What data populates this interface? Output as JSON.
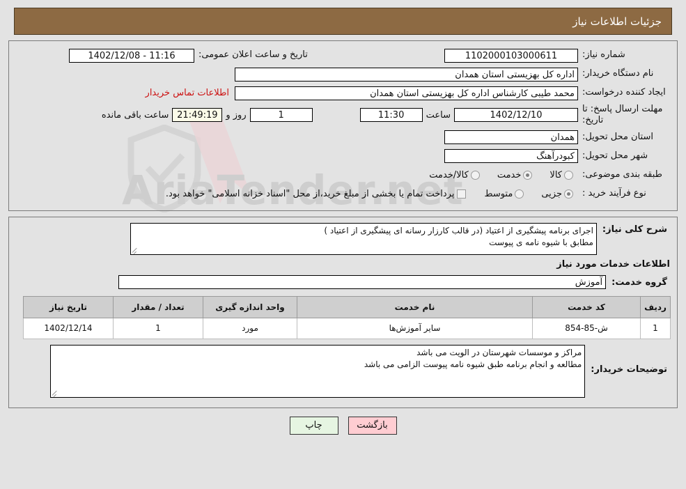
{
  "header": {
    "title": "جزئیات اطلاعات نیاز"
  },
  "form": {
    "need_number_label": "شماره نیاز:",
    "need_number_value": "1102000103000611",
    "announce_label": "تاریخ و ساعت اعلان عمومی:",
    "announce_value": "11:16 - 1402/12/08",
    "buyer_org_label": "نام دستگاه خریدار:",
    "buyer_org_value": "اداره کل بهزیستی استان همدان",
    "creator_label": "ایجاد کننده درخواست:",
    "creator_value": "محمد طیبی کارشناس اداره کل بهزیستی استان همدان",
    "contact_link": "اطلاعات تماس خریدار",
    "deadline_label": "مهلت ارسال پاسخ: تا تاریخ:",
    "deadline_date": "1402/12/10",
    "hour_word": "ساعت",
    "deadline_time": "11:30",
    "remaining_days": "1",
    "days_word": "روز و",
    "remaining_timer": "21:49:19",
    "remaining_suffix": "ساعت باقی مانده",
    "province_label": "استان محل تحویل:",
    "province_value": "همدان",
    "city_label": "شهر محل تحویل:",
    "city_value": "کبودرآهنگ",
    "category_label": "طبقه بندی موضوعی:",
    "category_options": [
      {
        "label": "کالا",
        "selected": false
      },
      {
        "label": "خدمت",
        "selected": true
      },
      {
        "label": "کالا/خدمت",
        "selected": false
      }
    ],
    "process_label": "نوع فرآیند خرید :",
    "process_options": [
      {
        "label": "جزیی",
        "selected": true
      },
      {
        "label": "متوسط",
        "selected": false
      }
    ],
    "treasury_checkbox_label": "پرداخت تمام یا بخشی از مبلغ خرید،از محل \"اسناد خزانه اسلامی\" خواهد بود."
  },
  "details": {
    "description_label": "شرح کلی نیاز:",
    "description_value": "اجرای برنامه پیشگیری از اعتیاد (در قالب کارزار رسانه ای پیشگیری از اعتیاد )\nمطابق با شیوه نامه ی پیوست",
    "services_section_title": "اطلاعات خدمات مورد نیاز",
    "service_group_label": "گروه خدمت:",
    "service_group_value": "آموزش",
    "table": {
      "headers": [
        "ردیف",
        "کد خدمت",
        "نام خدمت",
        "واحد اندازه گیری",
        "تعداد / مقدار",
        "تاریخ نیاز"
      ],
      "rows": [
        [
          "1",
          "ش-85-854",
          "سایر آموزش‌ها",
          "مورد",
          "1",
          "1402/12/14"
        ]
      ]
    },
    "notes_label": "توضیحات خریدار:",
    "notes_value": "مراکز و موسسات شهرستان در الویت می باشد\nمطالعه و  انجام برنامه طبق شیوه نامه پیوست الزامی می باشد"
  },
  "footer": {
    "back_label": "بازگشت",
    "print_label": "چاپ"
  },
  "watermark": {
    "text": "AriaTender.net"
  },
  "colors": {
    "header_bg": "#8d6a43",
    "link": "#cc1111",
    "timer_bg": "#fbfbe8",
    "back_btn": "#ffcdd2",
    "print_btn": "#e6f5e2"
  }
}
